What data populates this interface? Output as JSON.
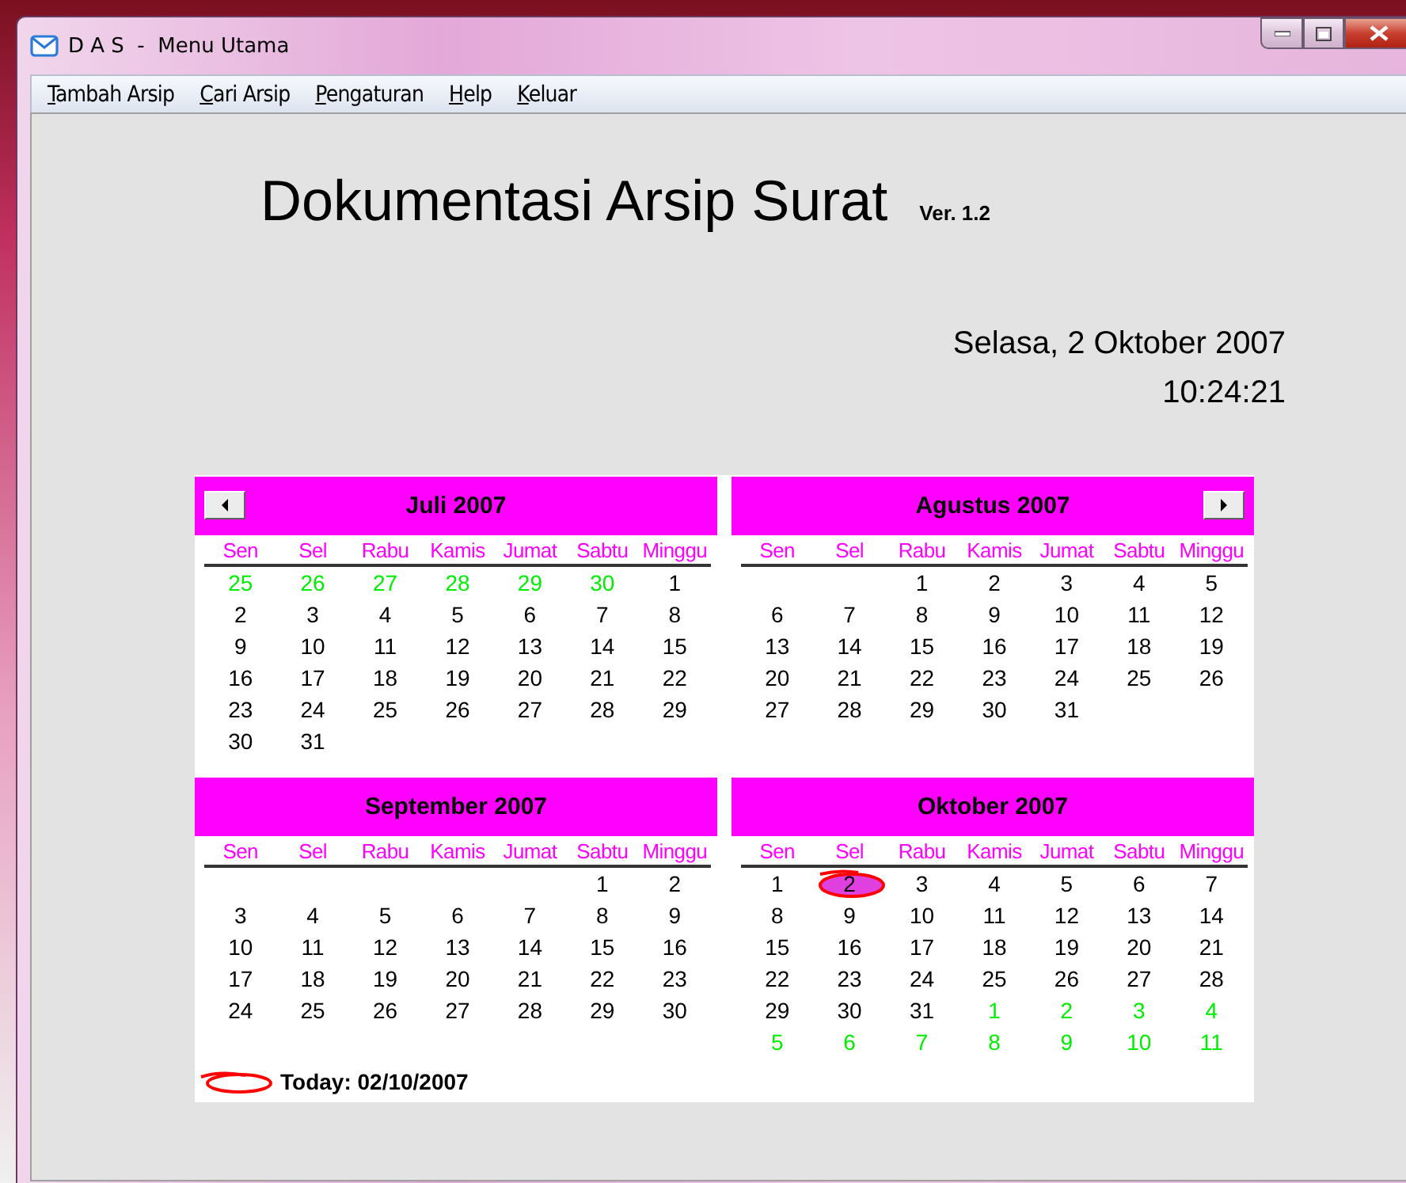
{
  "window": {
    "title": "D A S  -  Menu Utama"
  },
  "menu": [
    {
      "label": "Tambah Arsip"
    },
    {
      "label": "Cari Arsip"
    },
    {
      "label": "Pengaturan"
    },
    {
      "label": "Help"
    },
    {
      "label": "Keluar"
    }
  ],
  "heading": {
    "title": "Dokumentasi Arsip Surat",
    "version": "Ver. 1.2"
  },
  "date": "Selasa, 2 Oktober 2007",
  "time": "10:24:21",
  "calendar": {
    "months": [
      {
        "name": "Juli 2007",
        "kind": "prev",
        "weekdays": [
          "Sen",
          "Sel",
          "Rabu",
          "Kamis",
          "Jumat",
          "Sabtu",
          "Minggu"
        ],
        "weeks": [
          {
            "days": [
              {
                "d": "25",
                "adj": true,
                "today": false
              },
              {
                "d": "26",
                "adj": true,
                "today": false
              },
              {
                "d": "27",
                "adj": true,
                "today": false
              },
              {
                "d": "28",
                "adj": true,
                "today": false
              },
              {
                "d": "29",
                "adj": true,
                "today": false
              },
              {
                "d": "30",
                "adj": true,
                "today": false
              },
              {
                "d": "1",
                "adj": false,
                "today": false
              }
            ]
          },
          {
            "days": [
              {
                "d": "2",
                "adj": false,
                "today": false
              },
              {
                "d": "3",
                "adj": false,
                "today": false
              },
              {
                "d": "4",
                "adj": false,
                "today": false
              },
              {
                "d": "5",
                "adj": false,
                "today": false
              },
              {
                "d": "6",
                "adj": false,
                "today": false
              },
              {
                "d": "7",
                "adj": false,
                "today": false
              },
              {
                "d": "8",
                "adj": false,
                "today": false
              }
            ]
          },
          {
            "days": [
              {
                "d": "9",
                "adj": false,
                "today": false
              },
              {
                "d": "10",
                "adj": false,
                "today": false
              },
              {
                "d": "11",
                "adj": false,
                "today": false
              },
              {
                "d": "12",
                "adj": false,
                "today": false
              },
              {
                "d": "13",
                "adj": false,
                "today": false
              },
              {
                "d": "14",
                "adj": false,
                "today": false
              },
              {
                "d": "15",
                "adj": false,
                "today": false
              }
            ]
          },
          {
            "days": [
              {
                "d": "16",
                "adj": false,
                "today": false
              },
              {
                "d": "17",
                "adj": false,
                "today": false
              },
              {
                "d": "18",
                "adj": false,
                "today": false
              },
              {
                "d": "19",
                "adj": false,
                "today": false
              },
              {
                "d": "20",
                "adj": false,
                "today": false
              },
              {
                "d": "21",
                "adj": false,
                "today": false
              },
              {
                "d": "22",
                "adj": false,
                "today": false
              }
            ]
          },
          {
            "days": [
              {
                "d": "23",
                "adj": false,
                "today": false
              },
              {
                "d": "24",
                "adj": false,
                "today": false
              },
              {
                "d": "25",
                "adj": false,
                "today": false
              },
              {
                "d": "26",
                "adj": false,
                "today": false
              },
              {
                "d": "27",
                "adj": false,
                "today": false
              },
              {
                "d": "28",
                "adj": false,
                "today": false
              },
              {
                "d": "29",
                "adj": false,
                "today": false
              }
            ]
          },
          {
            "right_aligned": false,
            "days": [
              {
                "d": "30",
                "adj": false,
                "today": false
              },
              {
                "d": "31",
                "adj": false,
                "today": false
              }
            ]
          }
        ]
      },
      {
        "name": "Agustus 2007",
        "kind": "next",
        "weekdays": [
          "Sen",
          "Sel",
          "Rabu",
          "Kamis",
          "Jumat",
          "Sabtu",
          "Minggu"
        ],
        "weeks": [
          {
            "right_aligned": true,
            "days": [
              {
                "d": "1",
                "adj": false,
                "today": false
              },
              {
                "d": "2",
                "adj": false,
                "today": false
              },
              {
                "d": "3",
                "adj": false,
                "today": false
              },
              {
                "d": "4",
                "adj": false,
                "today": false
              },
              {
                "d": "5",
                "adj": false,
                "today": false
              }
            ]
          },
          {
            "days": [
              {
                "d": "6",
                "adj": false,
                "today": false
              },
              {
                "d": "7",
                "adj": false,
                "today": false
              },
              {
                "d": "8",
                "adj": false,
                "today": false
              },
              {
                "d": "9",
                "adj": false,
                "today": false
              },
              {
                "d": "10",
                "adj": false,
                "today": false
              },
              {
                "d": "11",
                "adj": false,
                "today": false
              },
              {
                "d": "12",
                "adj": false,
                "today": false
              }
            ]
          },
          {
            "days": [
              {
                "d": "13",
                "adj": false,
                "today": false
              },
              {
                "d": "14",
                "adj": false,
                "today": false
              },
              {
                "d": "15",
                "adj": false,
                "today": false
              },
              {
                "d": "16",
                "adj": false,
                "today": false
              },
              {
                "d": "17",
                "adj": false,
                "today": false
              },
              {
                "d": "18",
                "adj": false,
                "today": false
              },
              {
                "d": "19",
                "adj": false,
                "today": false
              }
            ]
          },
          {
            "days": [
              {
                "d": "20",
                "adj": false,
                "today": false
              },
              {
                "d": "21",
                "adj": false,
                "today": false
              },
              {
                "d": "22",
                "adj": false,
                "today": false
              },
              {
                "d": "23",
                "adj": false,
                "today": false
              },
              {
                "d": "24",
                "adj": false,
                "today": false
              },
              {
                "d": "25",
                "adj": false,
                "today": false
              },
              {
                "d": "26",
                "adj": false,
                "today": false
              }
            ]
          },
          {
            "right_aligned": false,
            "days": [
              {
                "d": "27",
                "adj": false,
                "today": false
              },
              {
                "d": "28",
                "adj": false,
                "today": false
              },
              {
                "d": "29",
                "adj": false,
                "today": false
              },
              {
                "d": "30",
                "adj": false,
                "today": false
              },
              {
                "d": "31",
                "adj": false,
                "today": false
              }
            ]
          }
        ]
      },
      {
        "name": "September 2007",
        "kind": "plain",
        "weekdays": [
          "Sen",
          "Sel",
          "Rabu",
          "Kamis",
          "Jumat",
          "Sabtu",
          "Minggu"
        ],
        "weeks": [
          {
            "right_aligned": true,
            "days": [
              {
                "d": "1",
                "adj": false,
                "today": false
              },
              {
                "d": "2",
                "adj": false,
                "today": false
              }
            ]
          },
          {
            "days": [
              {
                "d": "3",
                "adj": false,
                "today": false
              },
              {
                "d": "4",
                "adj": false,
                "today": false
              },
              {
                "d": "5",
                "adj": false,
                "today": false
              },
              {
                "d": "6",
                "adj": false,
                "today": false
              },
              {
                "d": "7",
                "adj": false,
                "today": false
              },
              {
                "d": "8",
                "adj": false,
                "today": false
              },
              {
                "d": "9",
                "adj": false,
                "today": false
              }
            ]
          },
          {
            "days": [
              {
                "d": "10",
                "adj": false,
                "today": false
              },
              {
                "d": "11",
                "adj": false,
                "today": false
              },
              {
                "d": "12",
                "adj": false,
                "today": false
              },
              {
                "d": "13",
                "adj": false,
                "today": false
              },
              {
                "d": "14",
                "adj": false,
                "today": false
              },
              {
                "d": "15",
                "adj": false,
                "today": false
              },
              {
                "d": "16",
                "adj": false,
                "today": false
              }
            ]
          },
          {
            "days": [
              {
                "d": "17",
                "adj": false,
                "today": false
              },
              {
                "d": "18",
                "adj": false,
                "today": false
              },
              {
                "d": "19",
                "adj": false,
                "today": false
              },
              {
                "d": "20",
                "adj": false,
                "today": false
              },
              {
                "d": "21",
                "adj": false,
                "today": false
              },
              {
                "d": "22",
                "adj": false,
                "today": false
              },
              {
                "d": "23",
                "adj": false,
                "today": false
              }
            ]
          },
          {
            "days": [
              {
                "d": "24",
                "adj": false,
                "today": false
              },
              {
                "d": "25",
                "adj": false,
                "today": false
              },
              {
                "d": "26",
                "adj": false,
                "today": false
              },
              {
                "d": "27",
                "adj": false,
                "today": false
              },
              {
                "d": "28",
                "adj": false,
                "today": false
              },
              {
                "d": "29",
                "adj": false,
                "today": false
              },
              {
                "d": "30",
                "adj": false,
                "today": false
              }
            ]
          }
        ]
      },
      {
        "name": "Oktober 2007",
        "kind": "plain",
        "weekdays": [
          "Sen",
          "Sel",
          "Rabu",
          "Kamis",
          "Jumat",
          "Sabtu",
          "Minggu"
        ],
        "weeks": [
          {
            "days": [
              {
                "d": "1",
                "adj": false,
                "today": false
              },
              {
                "d": "2",
                "adj": false,
                "today": true
              },
              {
                "d": "3",
                "adj": false,
                "today": false
              },
              {
                "d": "4",
                "adj": false,
                "today": false
              },
              {
                "d": "5",
                "adj": false,
                "today": false
              },
              {
                "d": "6",
                "adj": false,
                "today": false
              },
              {
                "d": "7",
                "adj": false,
                "today": false
              }
            ]
          },
          {
            "days": [
              {
                "d": "8",
                "adj": false,
                "today": false
              },
              {
                "d": "9",
                "adj": false,
                "today": false
              },
              {
                "d": "10",
                "adj": false,
                "today": false
              },
              {
                "d": "11",
                "adj": false,
                "today": false
              },
              {
                "d": "12",
                "adj": false,
                "today": false
              },
              {
                "d": "13",
                "adj": false,
                "today": false
              },
              {
                "d": "14",
                "adj": false,
                "today": false
              }
            ]
          },
          {
            "days": [
              {
                "d": "15",
                "adj": false,
                "today": false
              },
              {
                "d": "16",
                "adj": false,
                "today": false
              },
              {
                "d": "17",
                "adj": false,
                "today": false
              },
              {
                "d": "18",
                "adj": false,
                "today": false
              },
              {
                "d": "19",
                "adj": false,
                "today": false
              },
              {
                "d": "20",
                "adj": false,
                "today": false
              },
              {
                "d": "21",
                "adj": false,
                "today": false
              }
            ]
          },
          {
            "days": [
              {
                "d": "22",
                "adj": false,
                "today": false
              },
              {
                "d": "23",
                "adj": false,
                "today": false
              },
              {
                "d": "24",
                "adj": false,
                "today": false
              },
              {
                "d": "25",
                "adj": false,
                "today": false
              },
              {
                "d": "26",
                "adj": false,
                "today": false
              },
              {
                "d": "27",
                "adj": false,
                "today": false
              },
              {
                "d": "28",
                "adj": false,
                "today": false
              }
            ]
          },
          {
            "days": [
              {
                "d": "29",
                "adj": false,
                "today": false
              },
              {
                "d": "30",
                "adj": false,
                "today": false
              },
              {
                "d": "31",
                "adj": false,
                "today": false
              },
              {
                "d": "1",
                "adj": true,
                "today": false
              },
              {
                "d": "2",
                "adj": true,
                "today": false
              },
              {
                "d": "3",
                "adj": true,
                "today": false
              },
              {
                "d": "4",
                "adj": true,
                "today": false
              }
            ]
          },
          {
            "days": [
              {
                "d": "5",
                "adj": true,
                "today": false
              },
              {
                "d": "6",
                "adj": true,
                "today": false
              },
              {
                "d": "7",
                "adj": true,
                "today": false
              },
              {
                "d": "8",
                "adj": true,
                "today": false
              },
              {
                "d": "9",
                "adj": true,
                "today": false
              },
              {
                "d": "10",
                "adj": true,
                "today": false
              },
              {
                "d": "11",
                "adj": true,
                "today": false
              }
            ]
          }
        ]
      }
    ],
    "today_label": "Today: 02/10/2007"
  }
}
